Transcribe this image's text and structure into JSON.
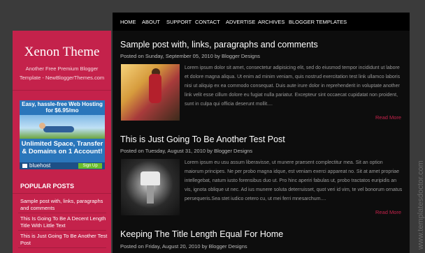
{
  "sidebar": {
    "site_title": "Xenon Theme",
    "site_description": "Another Free Premium Blogger Template - NewBloggerThemes.com",
    "ad": {
      "line1": "Easy, hassle-free Web Hosting",
      "line2": "for $6.95/mo",
      "line3": "Unlimited Space, Transfer",
      "line4": "& Domains on 1 Account!",
      "brand": "bluehost",
      "cta": "Sign Up Now"
    },
    "popular_posts_title": "POPULAR POSTS",
    "popular_posts": [
      "Sample post with, links, paragraphs and comments",
      "This Is Going To Be A Decent Length Title With Little Text",
      "This is Just Going To Be Another Test Post"
    ]
  },
  "nav": {
    "items": [
      "HOME",
      "ABOUT",
      "SUPPORT",
      "CONTACT",
      "ADVERTISE",
      "ARCHIVES",
      "BLOGGER TEMPLATES"
    ]
  },
  "posts": [
    {
      "title": "Sample post with, links, paragraphs and comments",
      "meta": "Posted on Sunday, September 05, 2010 by Blogger Designs",
      "excerpt": "Lorem ipsum dolor sit amet, consectetur adipisicing elit, sed do eiusmod tempor incididunt ut labore et dolore magna aliqua. Ut enim ad minim veniam, quis nostrud exercitation test link ullamco laboris nisi ut aliquip ex ea commodo consequat. Duis aute irure dolor in reprehenderit in voluptate another link velit esse cillum dolore eu fugiat nulla pariatur. Excepteur sint occaecat cupidatat non proident, sunt in culpa qui officia deserunt mollit....",
      "read_more": "Read More"
    },
    {
      "title": "This is Just Going To Be Another Test Post",
      "meta": "Posted on Tuesday, August 31, 2010 by Blogger Designs",
      "excerpt": "Lorem ipsum eu usu assum liberavisse, ut munere praesent complectitur mea. Sit an option maiorum principes. Ne per probo magna idque, est veniam exerci appareat no. Sit at amet propriae intellegebat, natum iusto forensibus duo ut. Pro hinc aperiri fabulas ut, probo tractatos euripidis an vis, ignota oblique ut nec. Ad ius munere soluta deterruisset, quot veri id vim, te vel bonorum ornatus persequeris.Sea stet iudico cetero cu, ut mei ferri mnesarchum....",
      "read_more": "Read More"
    },
    {
      "title": "Keeping The Title Length Equal For Home",
      "meta": "Posted on Friday, August 20, 2010 by Blogger Designs"
    }
  ],
  "watermark": "www.templatesdoctor.com",
  "colors": {
    "accent": "#c4224b",
    "background": "#3b3b3b",
    "content_background": "#0d0d0d",
    "nav_background": "#000000"
  }
}
